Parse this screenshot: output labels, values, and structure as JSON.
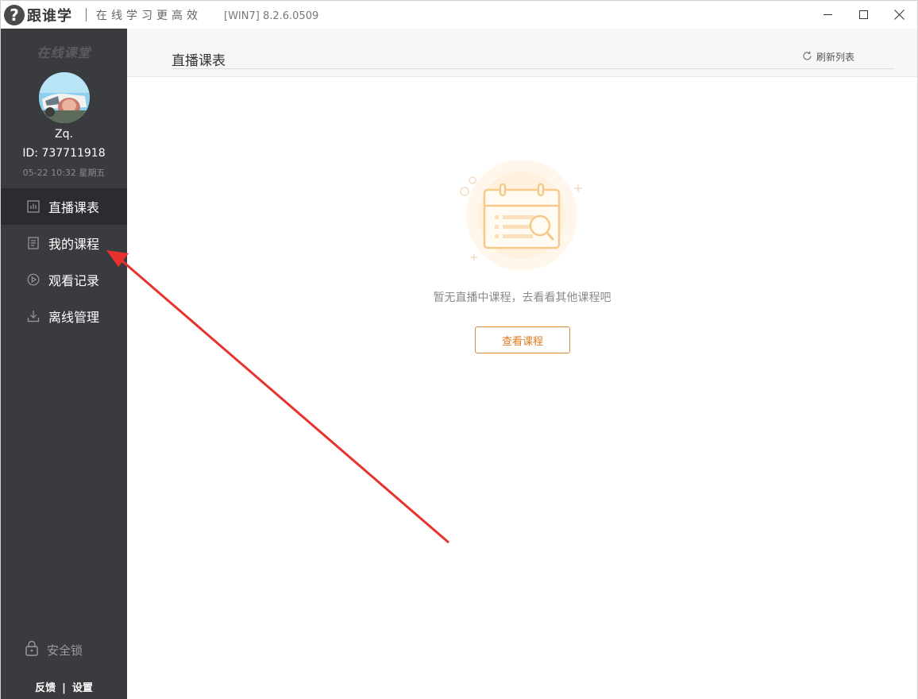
{
  "titlebar": {
    "logo_mark": "?",
    "app_name": "跟谁学",
    "slogan": "在线学习更高效",
    "version": "[WIN7] 8.2.6.0509"
  },
  "sidebar": {
    "brand": "在线课堂",
    "user": {
      "name": "Zq.",
      "id_text": "ID: 737711918",
      "datetime": "05-22  10:32  星期五"
    },
    "items": [
      {
        "label": "直播课表",
        "icon": "chart-icon",
        "active": true
      },
      {
        "label": "我的课程",
        "icon": "document-icon",
        "active": false
      },
      {
        "label": "观看记录",
        "icon": "play-circle-icon",
        "active": false
      },
      {
        "label": "离线管理",
        "icon": "download-icon",
        "active": false
      }
    ],
    "lock_label": "安全锁",
    "feedback_label": "反馈",
    "divider": "|",
    "settings_label": "设置"
  },
  "main": {
    "title": "直播课表",
    "refresh_label": "刷新列表",
    "empty_text": "暂无直播中课程，去看看其他课程吧",
    "view_button": "查看课程"
  },
  "colors": {
    "sidebar_bg": "#3a3b3f",
    "sidebar_active": "#2b2c30",
    "accent_orange": "#e07b22",
    "annotation_arrow": "#e8322e"
  }
}
